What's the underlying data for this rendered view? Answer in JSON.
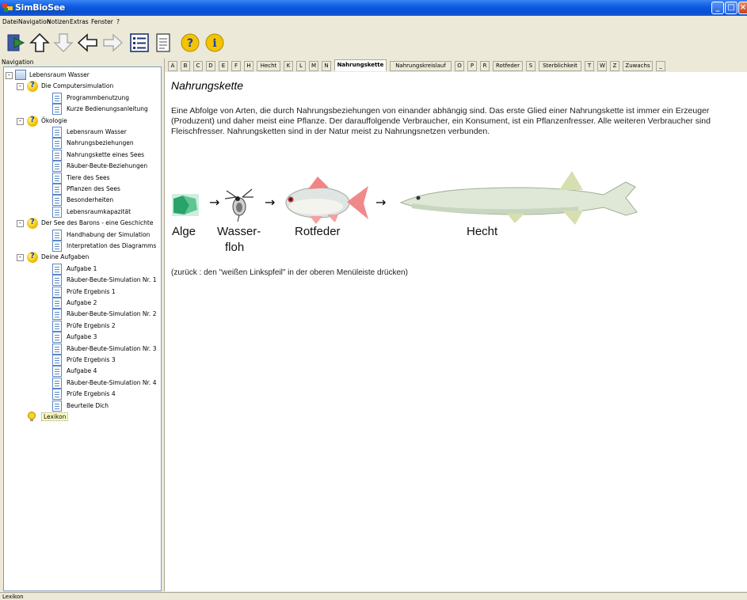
{
  "window": {
    "title": "SimBioSee"
  },
  "menu": [
    "Datei",
    "Navigation",
    "Notizen",
    "Extras",
    "Fenster",
    "?"
  ],
  "toolbar": {
    "buttons": [
      "exit-icon",
      "home-icon",
      "down-arrow-icon",
      "back-arrow-icon",
      "forward-arrow-icon",
      "outline-icon",
      "document-icon",
      "help-icon",
      "info-icon"
    ]
  },
  "navigation": {
    "label": "Navigation",
    "items": [
      {
        "label": "Lebensraum Wasser",
        "level": 0,
        "icon": "book-icon",
        "expander": "-"
      },
      {
        "label": "Die Computersimulation",
        "level": 1,
        "icon": "help-icon",
        "expander": "-"
      },
      {
        "label": "Programmbenutzung",
        "level": 2,
        "icon": "page-icon"
      },
      {
        "label": "Kurze Bedienungsanleitung",
        "level": 2,
        "icon": "page-icon"
      },
      {
        "label": "Ökologie",
        "level": 1,
        "icon": "help-icon",
        "expander": "-"
      },
      {
        "label": "Lebensraum Wasser",
        "level": 2,
        "icon": "page-icon"
      },
      {
        "label": "Nahrungsbeziehungen",
        "level": 2,
        "icon": "page-icon"
      },
      {
        "label": "Nahrungskette eines Sees",
        "level": 2,
        "icon": "page-icon"
      },
      {
        "label": "Räuber-Beute-Beziehungen",
        "level": 2,
        "icon": "page-icon"
      },
      {
        "label": "Tiere des Sees",
        "level": 2,
        "icon": "page-icon"
      },
      {
        "label": "Pflanzen des Sees",
        "level": 2,
        "icon": "page-icon"
      },
      {
        "label": "Besonderheiten",
        "level": 2,
        "icon": "page-icon"
      },
      {
        "label": "Lebensraumkapazität",
        "level": 2,
        "icon": "page-icon"
      },
      {
        "label": "Der See des Barons - eine Geschichte",
        "level": 1,
        "icon": "help-icon",
        "expander": "-"
      },
      {
        "label": "Handhabung der Simulation",
        "level": 2,
        "icon": "page-icon"
      },
      {
        "label": "Interpretation des Diagramms",
        "level": 2,
        "icon": "page-icon"
      },
      {
        "label": "Deine Aufgaben",
        "level": 1,
        "icon": "help-icon",
        "expander": "-"
      },
      {
        "label": "Aufgabe 1",
        "level": 2,
        "icon": "page-icon"
      },
      {
        "label": "Räuber-Beute-Simulation Nr. 1",
        "level": 2,
        "icon": "page-icon"
      },
      {
        "label": "Prüfe Ergebnis 1",
        "level": 2,
        "icon": "page-icon"
      },
      {
        "label": "Aufgabe 2",
        "level": 2,
        "icon": "page-icon"
      },
      {
        "label": "Räuber-Beute-Simulation Nr. 2",
        "level": 2,
        "icon": "page-icon"
      },
      {
        "label": "Prüfe Ergebnis 2",
        "level": 2,
        "icon": "page-icon"
      },
      {
        "label": "Aufgabe 3",
        "level": 2,
        "icon": "page-icon"
      },
      {
        "label": "Räuber-Beute-Simulation Nr. 3",
        "level": 2,
        "icon": "page-icon"
      },
      {
        "label": "Prüfe Ergebnis 3",
        "level": 2,
        "icon": "page-icon"
      },
      {
        "label": "Aufgabe 4",
        "level": 2,
        "icon": "page-icon"
      },
      {
        "label": "Räuber-Beute-Simulation Nr. 4",
        "level": 2,
        "icon": "page-icon"
      },
      {
        "label": "Prüfe Ergebnis 4",
        "level": 2,
        "icon": "page-icon"
      },
      {
        "label": "Beurteile Dich",
        "level": 2,
        "icon": "page-icon"
      },
      {
        "label": "Lexikon",
        "level": 1,
        "icon": "bulb-icon",
        "selected": true
      }
    ]
  },
  "tabs": [
    "A",
    "B",
    "C",
    "D",
    "E",
    "F",
    "H",
    "Hecht",
    "K",
    "L",
    "M",
    "N",
    "Nahrungskette",
    "Nahrungskreislauf",
    "O",
    "P",
    "R",
    "Rotfeder",
    "S",
    "Sterblichkeit",
    "T",
    "W",
    "Z",
    "Zuwachs",
    "_"
  ],
  "active_tab": "Nahrungskette",
  "page": {
    "title": "Nahrungskette",
    "description": "Eine Abfolge von Arten, die durch Nahrungsbeziehungen von einander abhängig sind. Das erste Glied einer Nahrungskette ist immer ein Erzeuger (Produzent) und daher meist eine Pflanze. Der darauffolgende Verbraucher, ein Konsument, ist ein Pflanzenfresser. Alle weiteren Verbraucher sind Fleischfresser. Nahrungsketten sind in der Natur meist zu Nahrungsnetzen verbunden.",
    "chain": {
      "alge": "Alge",
      "wasserfloh_line1": "Wasser-",
      "wasserfloh_line2": "floh",
      "rotfeder": "Rotfeder",
      "hecht": "Hecht",
      "arrow": "→"
    },
    "back_note": "(zurück : den \"weißen Linkspfeil\" in der oberen Menüleiste drücken)"
  },
  "status": {
    "text": "Lexikon"
  },
  "colors": {
    "titlebar": "#0a5ae0",
    "panel_bg": "#ece9d8",
    "selected": "#ffffc0"
  }
}
